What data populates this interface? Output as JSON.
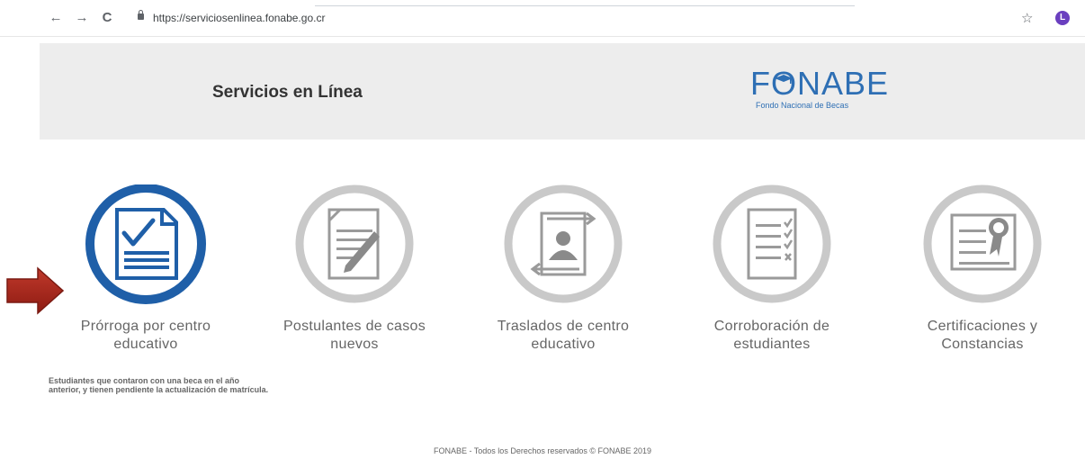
{
  "browser": {
    "url": "https://serviciosenlinea.fonabe.go.cr",
    "back_icon": "←",
    "forward_icon": "→",
    "reload_icon": "C",
    "star_icon": "☆",
    "avatar_letter": "L"
  },
  "header": {
    "title": "Servicios en Línea",
    "logo_text": "FONABE",
    "logo_subtitle": "Fondo Nacional de Becas",
    "brand_color": "#2e6fb4"
  },
  "services": [
    {
      "label": "Prórroga por centro educativo",
      "icon": "document-check-icon",
      "active": true,
      "description": "Estudiantes que contaron con una beca en el año anterior, y tienen pendiente la actualización de matrícula."
    },
    {
      "label": "Postulantes de casos nuevos",
      "icon": "document-pencil-icon",
      "active": false
    },
    {
      "label": "Traslados de centro educativo",
      "icon": "transfer-person-icon",
      "active": false
    },
    {
      "label": "Corroboración de estudiantes",
      "icon": "checklist-icon",
      "active": false
    },
    {
      "label": "Certificaciones y Constancias",
      "icon": "certificate-icon",
      "active": false
    }
  ],
  "footer": {
    "text": "FONABE - Todos los Derechos reservados © FONABE 2019"
  }
}
